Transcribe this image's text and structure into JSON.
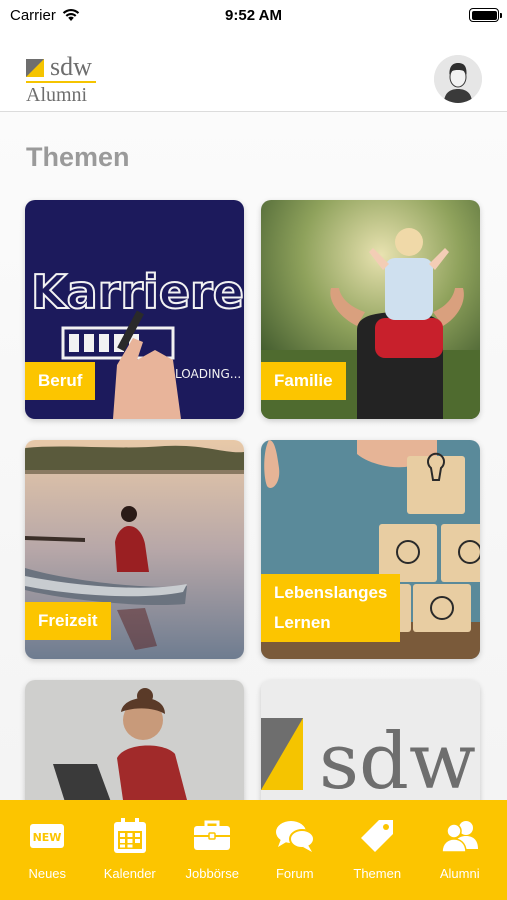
{
  "status_bar": {
    "carrier": "Carrier",
    "time": "9:52 AM"
  },
  "header": {
    "logo_text": "sdw",
    "logo_subtext": "Alumni"
  },
  "page": {
    "title": "Themen"
  },
  "tiles": [
    {
      "label": "Beruf",
      "image_text": "Karriere",
      "image_subtext": "LOADING..."
    },
    {
      "label": "Familie"
    },
    {
      "label": "Freizeit"
    },
    {
      "label_line1": "Lebenslanges",
      "label_line2": "Lernen"
    },
    {
      "label": ""
    },
    {
      "image_text": "sdw"
    }
  ],
  "tabbar": {
    "items": [
      {
        "label": "Neues",
        "icon": "new-icon"
      },
      {
        "label": "Kalender",
        "icon": "calendar-icon"
      },
      {
        "label": "Jobbörse",
        "icon": "briefcase-icon"
      },
      {
        "label": "Forum",
        "icon": "chat-bubbles-icon"
      },
      {
        "label": "Themen",
        "icon": "tag-icon"
      },
      {
        "label": "Alumni",
        "icon": "users-icon"
      }
    ]
  },
  "colors": {
    "accent": "#fcc500",
    "title_gray": "#9a9a9a",
    "logo_gray": "#6e6e6e"
  }
}
